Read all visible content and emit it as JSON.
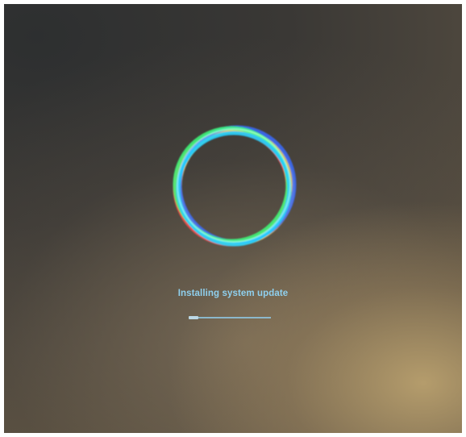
{
  "screen": {
    "status_text": "Installing system update",
    "progress": 0.12,
    "accent_color": "#8fd0ee",
    "icon": "android-update-ring-icon"
  }
}
